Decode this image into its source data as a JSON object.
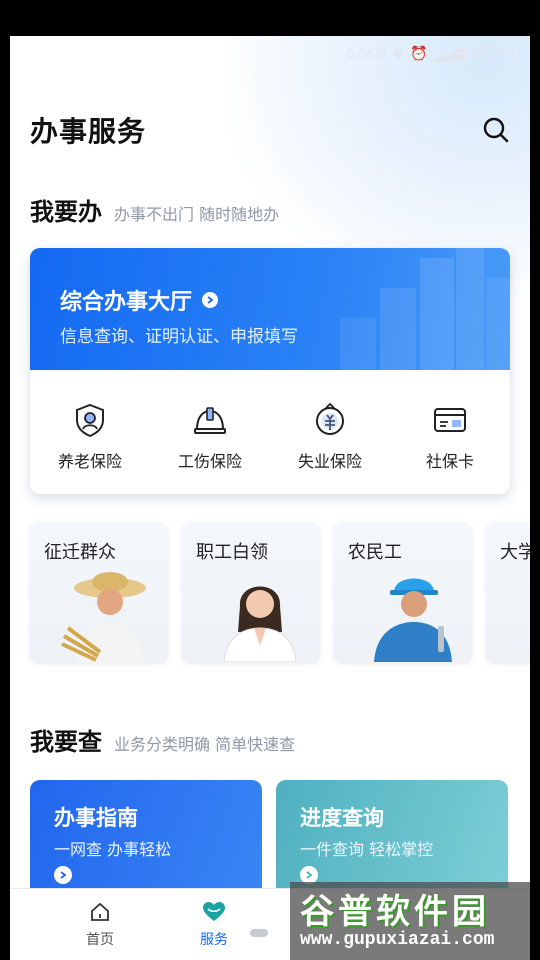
{
  "status_bar": {
    "net_speed": "0.0K/s",
    "signal": "4G",
    "battery": "24"
  },
  "header": {
    "title": "办事服务"
  },
  "do_section": {
    "title": "我要办",
    "subtitle": "办事不出门 随时随地办"
  },
  "hall": {
    "title": "综合办事大厅",
    "subtitle": "信息查询、证明认证、申报填写",
    "services": [
      {
        "label": "养老保险",
        "icon": "pension-shield-icon"
      },
      {
        "label": "工伤保险",
        "icon": "hardhat-icon"
      },
      {
        "label": "失业保险",
        "icon": "unemployment-badge-icon"
      },
      {
        "label": "社保卡",
        "icon": "social-security-card-icon"
      }
    ]
  },
  "groups": [
    {
      "label": "征迁群众"
    },
    {
      "label": "职工白领"
    },
    {
      "label": "农民工"
    },
    {
      "label": "大学"
    }
  ],
  "query_section": {
    "title": "我要查",
    "subtitle": "业务分类明确 简单快速查"
  },
  "query_cards": [
    {
      "title": "办事指南",
      "subtitle": "一网查 办事轻松",
      "color": "#2a6ff0"
    },
    {
      "title": "进度查询",
      "subtitle": "一件查询 轻松掌控",
      "color": "#56b7c4"
    }
  ],
  "tabs": [
    {
      "label": "首页",
      "active": false
    },
    {
      "label": "服务",
      "active": true
    }
  ],
  "watermark": {
    "line1": "谷普软件园",
    "line2": "www.gupuxiazai.com"
  },
  "colors": {
    "accent": "#1469f2",
    "tab_active": "#1469f2",
    "tab_inactive": "#555555"
  }
}
